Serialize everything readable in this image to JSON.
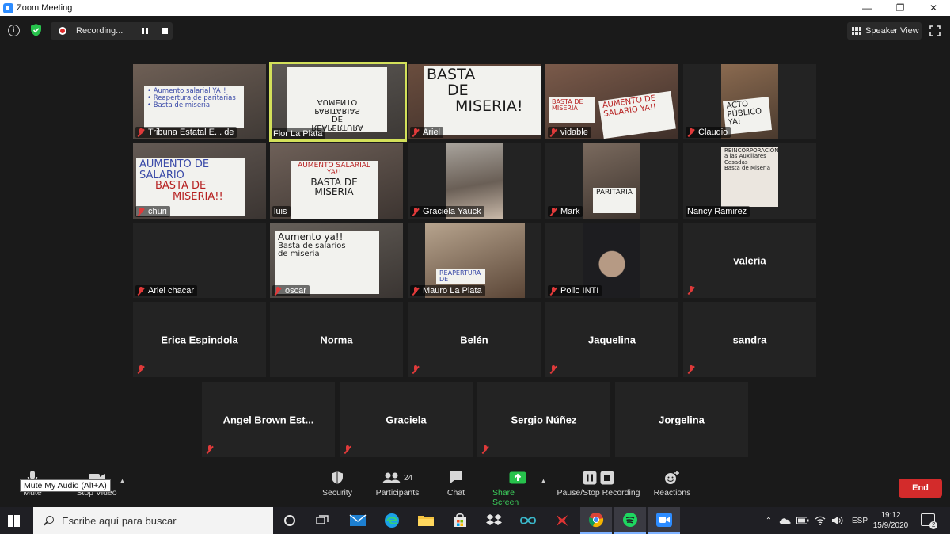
{
  "window": {
    "title": "Zoom Meeting",
    "minimize": "—",
    "restore": "❐",
    "close": "✕"
  },
  "topbar": {
    "info": "i",
    "recording_label": "Recording...",
    "speaker_view_label": "Speaker View"
  },
  "participants": [
    {
      "name": "Tribuna Estatal E... de",
      "sign": [
        "• Aumento salarial YA!!",
        "• Reapertura de paritarias",
        "• Basta de miseria"
      ]
    },
    {
      "name": "Flor La Plata",
      "sign": [
        "REAPERTURA",
        "DE",
        "PARITARIAS",
        "AUMENTO"
      ],
      "active": true
    },
    {
      "name": "Ariel",
      "sign": [
        "BASTA",
        "DE",
        "MISERIA!"
      ]
    },
    {
      "name": "vidable",
      "sign": [
        "BASTA DE MISERIA",
        "AUMENTO DE SALARIO YA!!"
      ]
    },
    {
      "name": "Claudio",
      "sign": [
        "ACTO",
        "PÚBLICO YA!"
      ]
    },
    {
      "name": "churi",
      "sign": [
        "AUMENTO DE SALARIO",
        "BASTA DE",
        "MISERIA!!"
      ]
    },
    {
      "name": "luis",
      "sign": [
        "AUMENTO SALARIAL",
        "YA!!",
        "BASTA DE",
        "MISERIA"
      ]
    },
    {
      "name": "Graciela Yauck",
      "sign": []
    },
    {
      "name": "Mark",
      "sign": [
        "PARITARIA"
      ]
    },
    {
      "name": "Nancy Ramirez",
      "sign": [
        "REINCORPORACIÓN",
        "a las Auxiliares",
        "Cesadas",
        "Basta de Miseria"
      ]
    },
    {
      "name": "Ariel chacar",
      "sign": []
    },
    {
      "name": "oscar",
      "sign": [
        "Aumento ya!!",
        "Basta de salarios",
        "de miseria"
      ]
    },
    {
      "name": "Mauro La Plata",
      "sign": [
        "REAPERTURA DE"
      ]
    },
    {
      "name": "Pollo INTI",
      "sign": []
    },
    {
      "name": "valeria"
    },
    {
      "name": "Erica Espindola"
    },
    {
      "name": "Norma"
    },
    {
      "name": "Belén"
    },
    {
      "name": "Jaquelina"
    },
    {
      "name": "sandra"
    },
    {
      "name": "Angel Brown Est..."
    },
    {
      "name": "Graciela"
    },
    {
      "name": "Sergio Núñez"
    },
    {
      "name": "Jorgelina"
    }
  ],
  "toolbar": {
    "mute": "Mute",
    "stop_video": "Stop Video",
    "security": "Security",
    "participants": "Participants",
    "participants_count": "24",
    "chat": "Chat",
    "share_screen": "Share Screen",
    "pause_stop_recording": "Pause/Stop Recording",
    "reactions": "Reactions",
    "end": "End",
    "mute_tooltip": "Mute My Audio (Alt+A)"
  },
  "taskbar": {
    "search_placeholder": "Escribe aquí para buscar",
    "language": "ESP",
    "time": "19:12",
    "date": "15/9/2020",
    "notifications": "2"
  },
  "colors": {
    "accent": "#2d8cff",
    "active_speaker": "#d3e05a",
    "end": "#d32b2b",
    "share": "#3ccd5c"
  }
}
